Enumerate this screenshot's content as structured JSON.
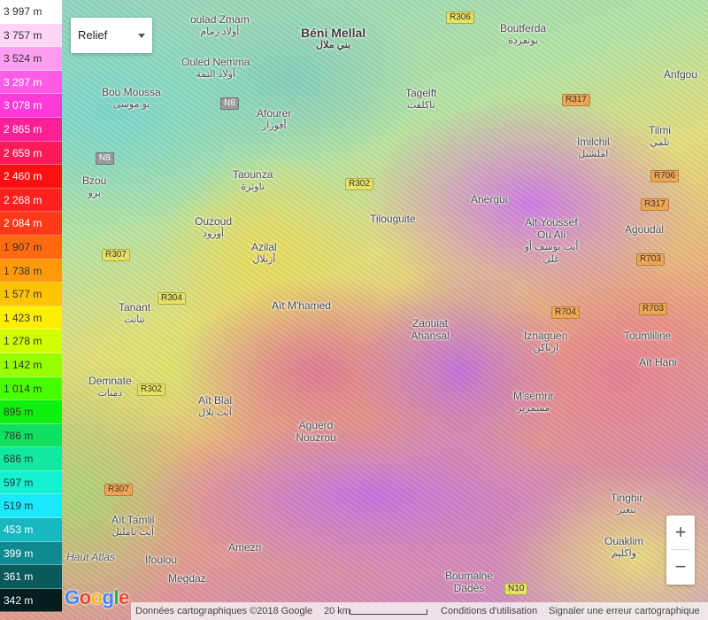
{
  "map_type": {
    "selected": "Relief"
  },
  "legend": {
    "items": [
      {
        "label": "3 997 m",
        "color": "#ffffff",
        "text_color": "#333333"
      },
      {
        "label": "3 757 m",
        "color": "#ffd4f4",
        "text_color": "#333333"
      },
      {
        "label": "3 524 m",
        "color": "#ff9ef0",
        "text_color": "#333333"
      },
      {
        "label": "3 297 m",
        "color": "#ff5ce6",
        "text_color": "#ffffff"
      },
      {
        "label": "3 078 m",
        "color": "#ff3ad8",
        "text_color": "#ffffff"
      },
      {
        "label": "2 865 m",
        "color": "#ff1f97",
        "text_color": "#ffffff"
      },
      {
        "label": "2 659 m",
        "color": "#ff1a5a",
        "text_color": "#ffffff"
      },
      {
        "label": "2 460 m",
        "color": "#ff1010",
        "text_color": "#ffffff"
      },
      {
        "label": "2 268 m",
        "color": "#ff2020",
        "text_color": "#ffffff"
      },
      {
        "label": "2 084 m",
        "color": "#ff3a1a",
        "text_color": "#ffffff"
      },
      {
        "label": "1 907 m",
        "color": "#ff6a10",
        "text_color": "#333333"
      },
      {
        "label": "1 738 m",
        "color": "#ff9a0a",
        "text_color": "#333333"
      },
      {
        "label": "1 577 m",
        "color": "#ffc400",
        "text_color": "#333333"
      },
      {
        "label": "1 423 m",
        "color": "#ffee00",
        "text_color": "#333333"
      },
      {
        "label": "1 278 m",
        "color": "#d2ff00",
        "text_color": "#333333"
      },
      {
        "label": "1 142 m",
        "color": "#96ff00",
        "text_color": "#333333"
      },
      {
        "label": "1 014 m",
        "color": "#48ff00",
        "text_color": "#333333"
      },
      {
        "label": "895 m",
        "color": "#10f010",
        "text_color": "#333333"
      },
      {
        "label": "786 m",
        "color": "#10e060",
        "text_color": "#333333"
      },
      {
        "label": "686 m",
        "color": "#12e8a0",
        "text_color": "#333333"
      },
      {
        "label": "597 m",
        "color": "#14f0d0",
        "text_color": "#333333"
      },
      {
        "label": "519 m",
        "color": "#1ae8ff",
        "text_color": "#333333"
      },
      {
        "label": "453 m",
        "color": "#18b8c0",
        "text_color": "#ffffff"
      },
      {
        "label": "399 m",
        "color": "#108a8e",
        "text_color": "#ffffff"
      },
      {
        "label": "361 m",
        "color": "#0a5a5c",
        "text_color": "#ffffff"
      },
      {
        "label": "342 m",
        "color": "#061e20",
        "text_color": "#ffffff"
      }
    ]
  },
  "places": [
    {
      "name": "oulad Zmam",
      "ar": "أولاد زمام"
    },
    {
      "name": "Béni Mellal",
      "ar": "بني ملال"
    },
    {
      "name": "Boutferda",
      "ar": "بوتفردة"
    },
    {
      "name": "Ouled Nemma",
      "ar": "أولاد النمة"
    },
    {
      "name": "Bou Moussa",
      "ar": "بو موسى"
    },
    {
      "name": "Afourer",
      "ar": "أفورار"
    },
    {
      "name": "Tagelft",
      "ar": "تاكلفت"
    },
    {
      "name": "Anfgou",
      "ar": ""
    },
    {
      "name": "Imilchil",
      "ar": "املشيل"
    },
    {
      "name": "Tilmi",
      "ar": "تلمي"
    },
    {
      "name": "Bzou",
      "ar": "بزو"
    },
    {
      "name": "Taounza",
      "ar": "تاونزة"
    },
    {
      "name": "Anergui",
      "ar": ""
    },
    {
      "name": "Tilouguite",
      "ar": ""
    },
    {
      "name": "Ait Youssef Ou Ali",
      "ar": "أيت يوسف أو علي"
    },
    {
      "name": "Agoudal",
      "ar": ""
    },
    {
      "name": "Ouzoud",
      "ar": "أوزود"
    },
    {
      "name": "Azilal",
      "ar": "أزيلال"
    },
    {
      "name": "Tanant",
      "ar": "تنانت"
    },
    {
      "name": "Aït M'hamed",
      "ar": ""
    },
    {
      "name": "Zaouiat Ahansal",
      "ar": ""
    },
    {
      "name": "Iznaguen",
      "ar": "إزناكن"
    },
    {
      "name": "Toumliline",
      "ar": ""
    },
    {
      "name": "Aït Hani",
      "ar": ""
    },
    {
      "name": "Demnate",
      "ar": "دمنات"
    },
    {
      "name": "Aït Blal",
      "ar": "آيت بلال"
    },
    {
      "name": "M'semrir",
      "ar": "مسمرير"
    },
    {
      "name": "Aguerd Nouzrou",
      "ar": ""
    },
    {
      "name": "Tinghir",
      "ar": "تنغير"
    },
    {
      "name": "Aït Tamlil",
      "ar": "أيت تامليل"
    },
    {
      "name": "Haut Atlas",
      "ar": ""
    },
    {
      "name": "Ifoulou",
      "ar": ""
    },
    {
      "name": "Amezri",
      "ar": ""
    },
    {
      "name": "Ouaklim",
      "ar": "واكليم"
    },
    {
      "name": "Megdaz",
      "ar": ""
    },
    {
      "name": "Boumalne Dadès",
      "ar": ""
    }
  ],
  "roads": [
    "R306",
    "N8",
    "R317",
    "N8",
    "R302",
    "R706",
    "R317",
    "R307",
    "R304",
    "R703",
    "R704",
    "R703",
    "R302",
    "R307",
    "N10"
  ],
  "zoom": {
    "in": "+",
    "out": "−"
  },
  "footer": {
    "logo": "Google",
    "map_data": "Données cartographiques ©2018 Google",
    "scale": "20 km",
    "terms": "Conditions d'utilisation",
    "report": "Signaler une erreur cartographique"
  }
}
